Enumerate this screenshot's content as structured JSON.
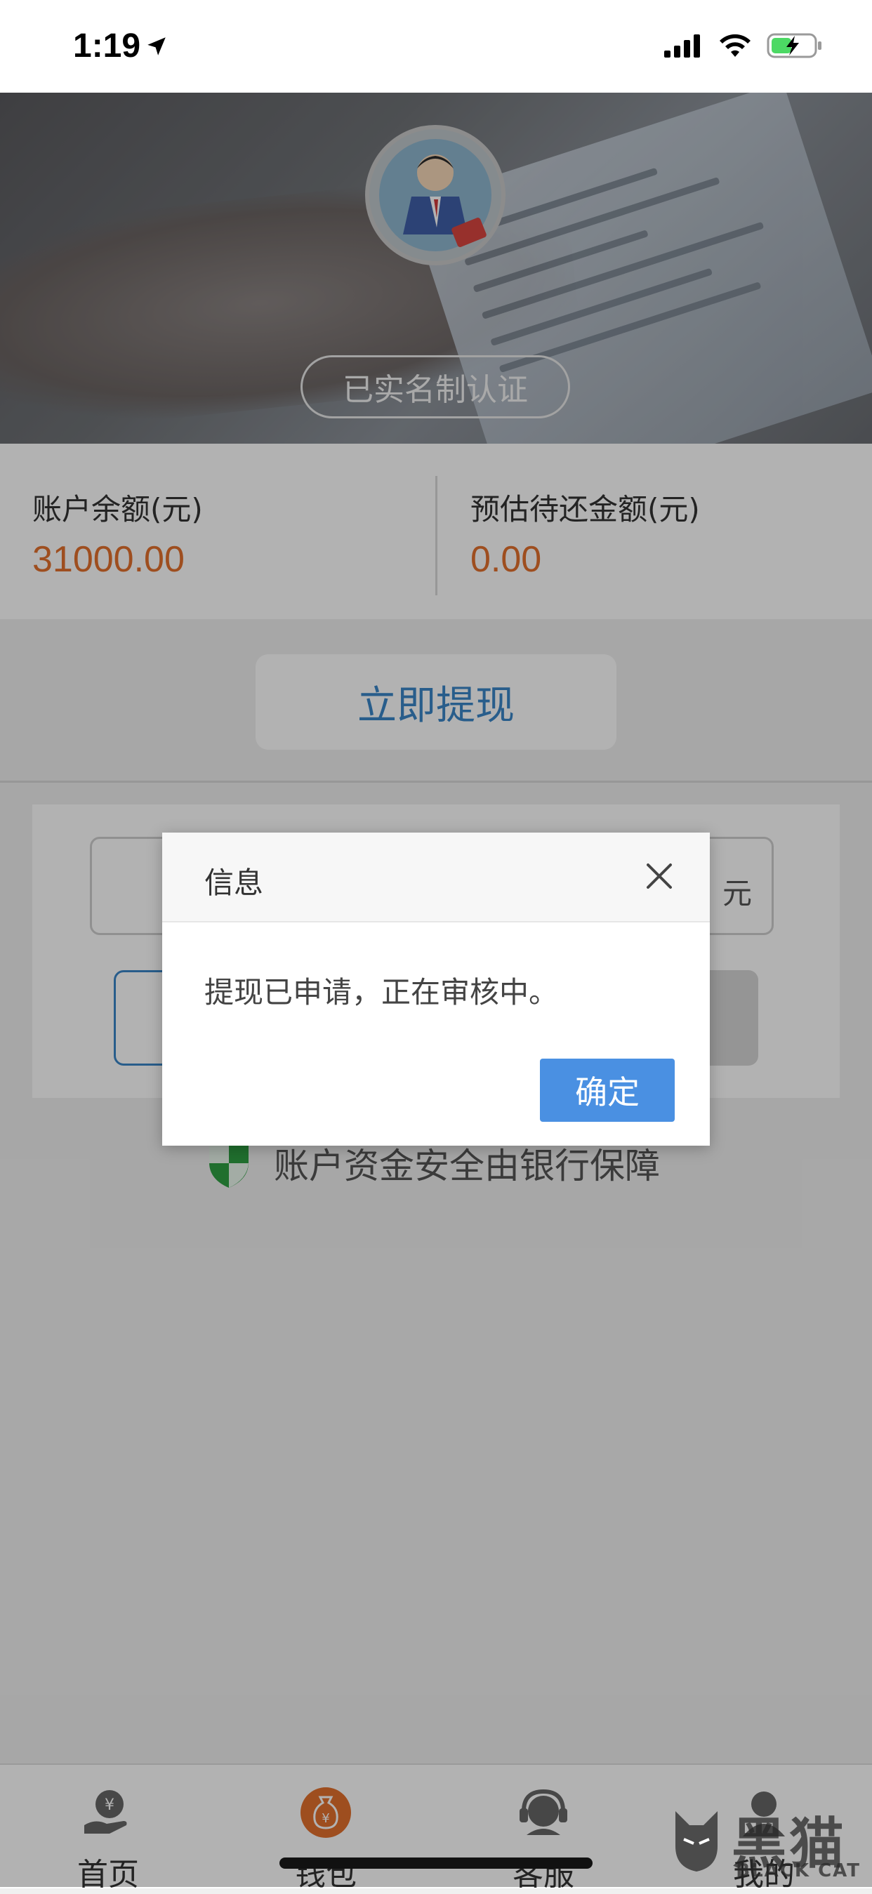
{
  "status_bar": {
    "time": "1:19"
  },
  "header": {
    "verify_badge": "已实名制认证"
  },
  "balance": {
    "account_label": "账户余额(元)",
    "account_value": "31000.00",
    "repay_label": "预估待还金额(元)",
    "repay_value": "0.00"
  },
  "withdraw": {
    "button_label": "立即提现"
  },
  "form": {
    "amount_unit": "元"
  },
  "security": {
    "note": "账户资金安全由银行保障"
  },
  "tabs": [
    {
      "label": "首页",
      "icon": "home-yuan-icon"
    },
    {
      "label": "钱包",
      "icon": "wallet-bag-icon"
    },
    {
      "label": "客服",
      "icon": "customer-service-icon"
    },
    {
      "label": "我的",
      "icon": "profile-icon"
    }
  ],
  "dialog": {
    "title": "信息",
    "message": "提现已申请，正在审核中。",
    "ok_label": "确定"
  },
  "watermark": {
    "cn": "黑猫",
    "en": "BLACK CAT"
  },
  "colors": {
    "accent_blue": "#4a90e2",
    "link_blue": "#3a86c8",
    "amount_orange": "#e2702d",
    "shield_green": "#2ea043"
  }
}
